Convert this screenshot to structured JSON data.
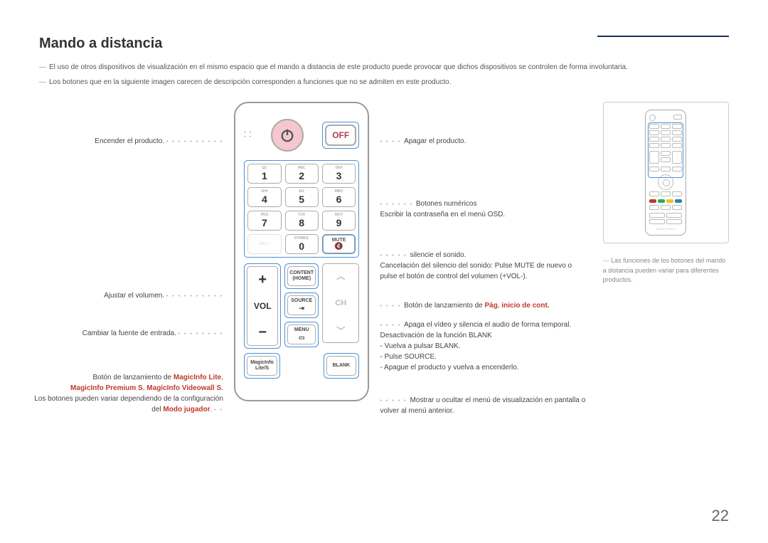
{
  "title": "Mando a distancia",
  "page_number": "22",
  "notes": {
    "n1": "El uso de otros dispositivos de visualización en el mismo espacio que el mando a distancia de este producto puede provocar que dichos dispositivos se controlen de forma involuntaria.",
    "n2": "Los botones que en la siguiente imagen carecen de descripción corresponden a funciones que no se admiten en este producto."
  },
  "side_note": "Las funciones de los botones del mando a distancia pueden variar para diferentes productos.",
  "labels_left": {
    "power_on": "Encender el producto.",
    "volume": "Ajustar el volumen.",
    "source": "Cambiar la fuente de entrada.",
    "magic_pre": "Botón de lanzamiento de ",
    "magic_link1": "MagicInfo Lite",
    "magic_link2": "MagicInfo Premium S",
    "magic_link3": "MagicInfo Videowall S",
    "magic_post1": "Los botones pueden variar dependiendo de la configuración del ",
    "magic_post2": "Modo jugador"
  },
  "labels_right": {
    "power_off": "Apagar el producto.",
    "numeric1": "Botones numéricos",
    "numeric2": "Escribir la contraseña en el menú OSD.",
    "mute1": "silencie el sonido.",
    "mute2": "Cancelación del silencio del sonido: Pulse MUTE de nuevo o pulse el botón de control del volumen (+VOL-).",
    "content_pre": "Botón de lanzamiento de ",
    "content_link": "Pág. inicio de cont.",
    "blank1": "Apaga el vídeo y silencia el audio de forma temporal.",
    "blank2": "Desactivación de la función BLANK",
    "blank3": "- Vuelva a pulsar BLANK.",
    "blank4": "- Pulse SOURCE.",
    "blank5": "- Apague el producto y vuelva a encenderlo.",
    "menu": "Mostrar u ocultar el menú de visualización en pantalla o volver al menú anterior."
  },
  "remote": {
    "off": "OFF",
    "keys_sub": [
      "QZ",
      "ABC",
      "DEF",
      "GHI",
      "JKL",
      "MNO",
      "PRS",
      "TUV",
      "WXY"
    ],
    "keys_num": [
      "1",
      "2",
      "3",
      "4",
      "5",
      "6",
      "7",
      "8",
      "9"
    ],
    "del": "DEL /-",
    "symbol": "SYMBOL",
    "zero": "0",
    "mute": "MUTE",
    "vol": "VOL",
    "plus": "+",
    "minus": "−",
    "ch": "CH",
    "content1": "CONTENT",
    "content2": "(HOME)",
    "source": "SOURCE",
    "menu": "MENU",
    "magicinfo1": "MagicInfo",
    "magicinfo2": "Lite/S",
    "blank": "BLANK",
    "brand": "SAMSUNG"
  }
}
